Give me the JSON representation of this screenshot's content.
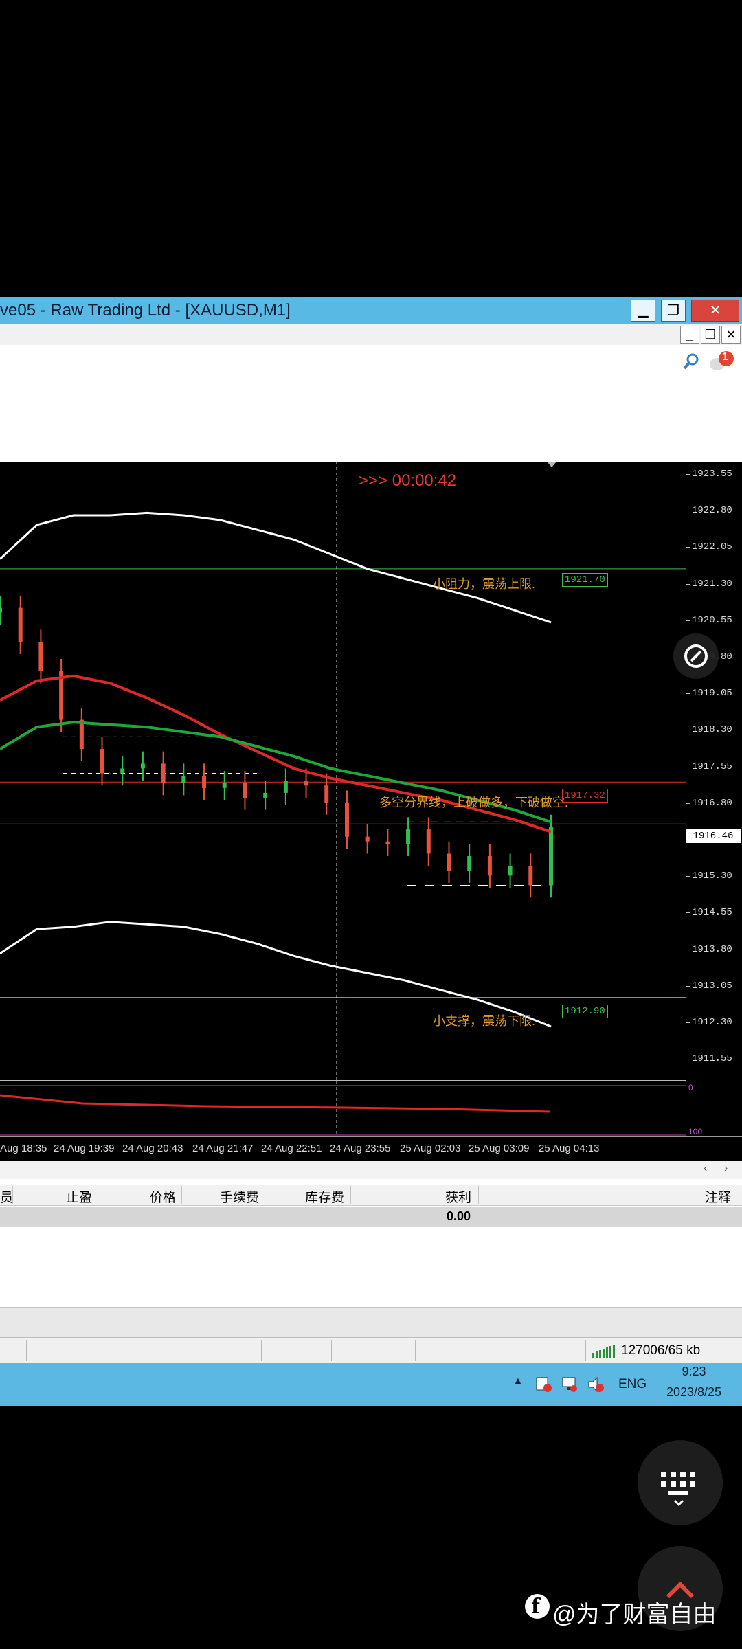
{
  "window": {
    "title": "ve05 - Raw Trading Ltd - [XAUUSD,M1]",
    "minimize": "▁",
    "maximize": "❐",
    "close": "✕"
  },
  "mdi": {
    "minimize": "_",
    "restore": "❐",
    "close": "✕"
  },
  "toolbar": {
    "notification_count": "1"
  },
  "chart": {
    "countdown": ">>> 00:00:42",
    "price_ticks": [
      "1923.55",
      "1922.80",
      "1922.05",
      "1921.30",
      "1920.55",
      "1919.80",
      "1919.05",
      "1918.30",
      "1917.55",
      "1916.80",
      "1916.05",
      "1915.30",
      "1914.55",
      "1913.80",
      "1913.05",
      "1912.30",
      "1911.55"
    ],
    "current_price": "1916.46",
    "resistance": {
      "label": "小阻力，震荡上限.",
      "price": "1921.70"
    },
    "pivot": {
      "label": "多空分界线，上破做多，下破做空.",
      "price": "1917.32"
    },
    "support": {
      "label": "小支撑，震荡下限.",
      "price": "1912.90"
    },
    "subwindow_top_value": "0",
    "subwindow_bottom_value": "100",
    "time_ticks": [
      "Aug 18:35",
      "24 Aug 19:39",
      "24 Aug 20:43",
      "24 Aug 21:47",
      "24 Aug 22:51",
      "24 Aug 23:55",
      "25 Aug 02:03",
      "25 Aug 03:09",
      "25 Aug 04:13"
    ]
  },
  "chart_data": {
    "type": "candlestick",
    "symbol": "XAUUSD",
    "timeframe": "M1",
    "ylim": [
      1911.2,
      1923.9
    ],
    "series": [
      {
        "name": "upper-band",
        "values": [
          1921.9,
          1922.6,
          1922.8,
          1922.8,
          1922.85,
          1922.8,
          1922.7,
          1922.5,
          1922.3,
          1922.0,
          1921.7,
          1921.5,
          1921.3,
          1921.1,
          1920.85,
          1920.6
        ]
      },
      {
        "name": "ma-red",
        "values": [
          1919.0,
          1919.4,
          1919.5,
          1919.35,
          1919.05,
          1918.7,
          1918.3,
          1917.95,
          1917.6,
          1917.4,
          1917.25,
          1917.1,
          1916.95,
          1916.75,
          1916.55,
          1916.3
        ]
      },
      {
        "name": "ma-green",
        "values": [
          1918.0,
          1918.45,
          1918.55,
          1918.5,
          1918.45,
          1918.35,
          1918.25,
          1918.05,
          1917.85,
          1917.6,
          1917.45,
          1917.3,
          1917.15,
          1916.95,
          1916.75,
          1916.5
        ]
      },
      {
        "name": "lower-band",
        "values": [
          1913.8,
          1914.3,
          1914.35,
          1914.45,
          1914.4,
          1914.35,
          1914.2,
          1914.0,
          1913.75,
          1913.55,
          1913.4,
          1913.25,
          1913.05,
          1912.85,
          1912.6,
          1912.3
        ]
      },
      {
        "name": "closes",
        "values": [
          1920.9,
          1920.2,
          1919.6,
          1918.6,
          1918.0,
          1917.5,
          1917.6,
          1917.7,
          1917.3,
          1917.45,
          1917.2,
          1917.3,
          1917.0,
          1917.1,
          1917.35,
          1917.25,
          1916.9,
          1916.2,
          1916.1,
          1916.05,
          1916.35,
          1915.85,
          1915.5,
          1915.8,
          1915.4,
          1915.6,
          1915.2,
          1916.4
        ]
      }
    ],
    "hlines": [
      1921.7,
      1917.32,
      1912.9,
      1916.46
    ],
    "grid": false
  },
  "terminal": {
    "columns": [
      "员",
      "止盈",
      "价格",
      "手续费",
      "库存费",
      "获利",
      "注释"
    ],
    "profit_total": "0.00"
  },
  "statusbar": {
    "connection": "127006/65 kb"
  },
  "taskbar": {
    "language": "ENG",
    "time": "9:23",
    "date": "2023/8/25"
  },
  "overlays": {
    "watermark": "@为了财富自由"
  },
  "colors": {
    "titlebar": "#58b9e4",
    "ma_red": "#e02828",
    "ma_green": "#1fa83a",
    "band": "#ffffff",
    "countdown": "#e0392e",
    "label": "#e09a2c"
  }
}
